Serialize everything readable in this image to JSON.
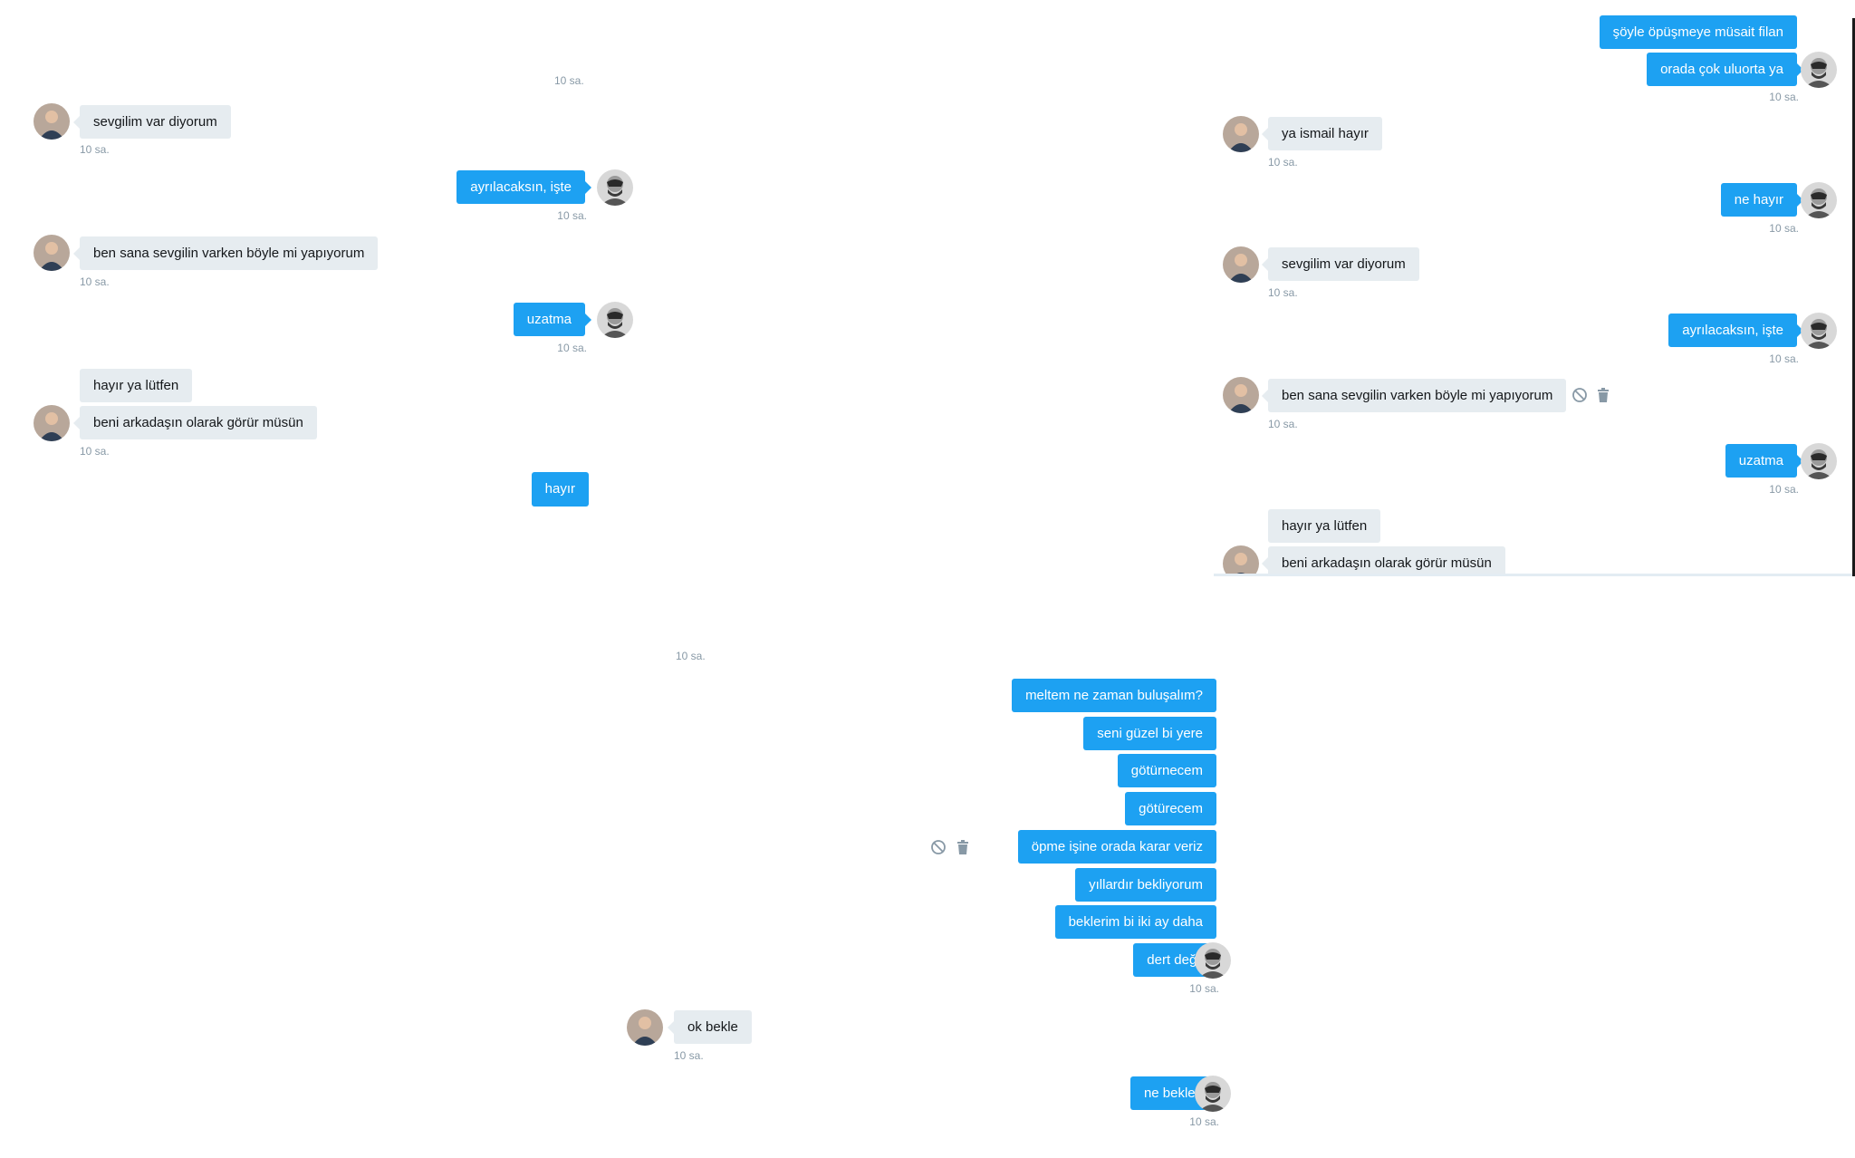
{
  "panel_a": {
    "timestamp_cut": "10 sa.",
    "messages": [
      {
        "dir": "in",
        "text": "sevgilim var diyorum",
        "time": "10 sa."
      },
      {
        "dir": "out",
        "text": "ayrılacaksın, işte",
        "time": "10 sa."
      },
      {
        "dir": "in",
        "text": "ben sana sevgilin varken böyle mi yapıyorum",
        "time": "10 sa."
      },
      {
        "dir": "out",
        "text": "uzatma",
        "time": "10 sa."
      },
      {
        "dir": "in",
        "text": "hayır ya lütfen"
      },
      {
        "dir": "in",
        "text": "beni arkadaşın olarak görür müsün",
        "time": "10 sa."
      },
      {
        "dir": "out",
        "text": "hayır"
      }
    ]
  },
  "panel_b": {
    "messages": [
      {
        "dir": "out",
        "text": "şöyle öpüşmeye müsait filan"
      },
      {
        "dir": "out",
        "text": "orada çok uluorta ya",
        "time": "10 sa."
      },
      {
        "dir": "in",
        "text": "ya ismail hayır",
        "time": "10 sa."
      },
      {
        "dir": "out",
        "text": "ne hayır",
        "time": "10 sa."
      },
      {
        "dir": "in",
        "text": "sevgilim var diyorum",
        "time": "10 sa."
      },
      {
        "dir": "out",
        "text": "ayrılacaksın, işte",
        "time": "10 sa."
      },
      {
        "dir": "in",
        "text": "ben sana sevgilin varken böyle mi yapıyorum",
        "time": "10 sa."
      },
      {
        "dir": "out",
        "text": "uzatma",
        "time": "10 sa."
      },
      {
        "dir": "in",
        "text": "hayır ya lütfen"
      },
      {
        "dir": "in",
        "text": "beni arkadaşın olarak görür müsün"
      }
    ]
  },
  "panel_c": {
    "timestamp_cut": "10 sa.",
    "messages": [
      {
        "dir": "out",
        "text": "meltem ne zaman buluşalım?"
      },
      {
        "dir": "out",
        "text": "seni güzel bi yere"
      },
      {
        "dir": "out",
        "text": "götürnecem"
      },
      {
        "dir": "out",
        "text": "götürecem"
      },
      {
        "dir": "out",
        "text": "öpme işine orada karar veriz"
      },
      {
        "dir": "out",
        "text": "yıllardır bekliyorum"
      },
      {
        "dir": "out",
        "text": "beklerim bi iki ay daha"
      },
      {
        "dir": "out",
        "text": "dert değil",
        "time": "10 sa."
      },
      {
        "dir": "in",
        "text": "ok bekle",
        "time": "10 sa."
      },
      {
        "dir": "out",
        "text": "ne bekle?",
        "time": "10 sa."
      }
    ]
  },
  "icons": {
    "block": "block-icon",
    "delete": "trash-icon"
  },
  "colors": {
    "outgoing": "#1da1f2",
    "incoming": "#e6ecf0",
    "timestamp": "#8899a6"
  }
}
